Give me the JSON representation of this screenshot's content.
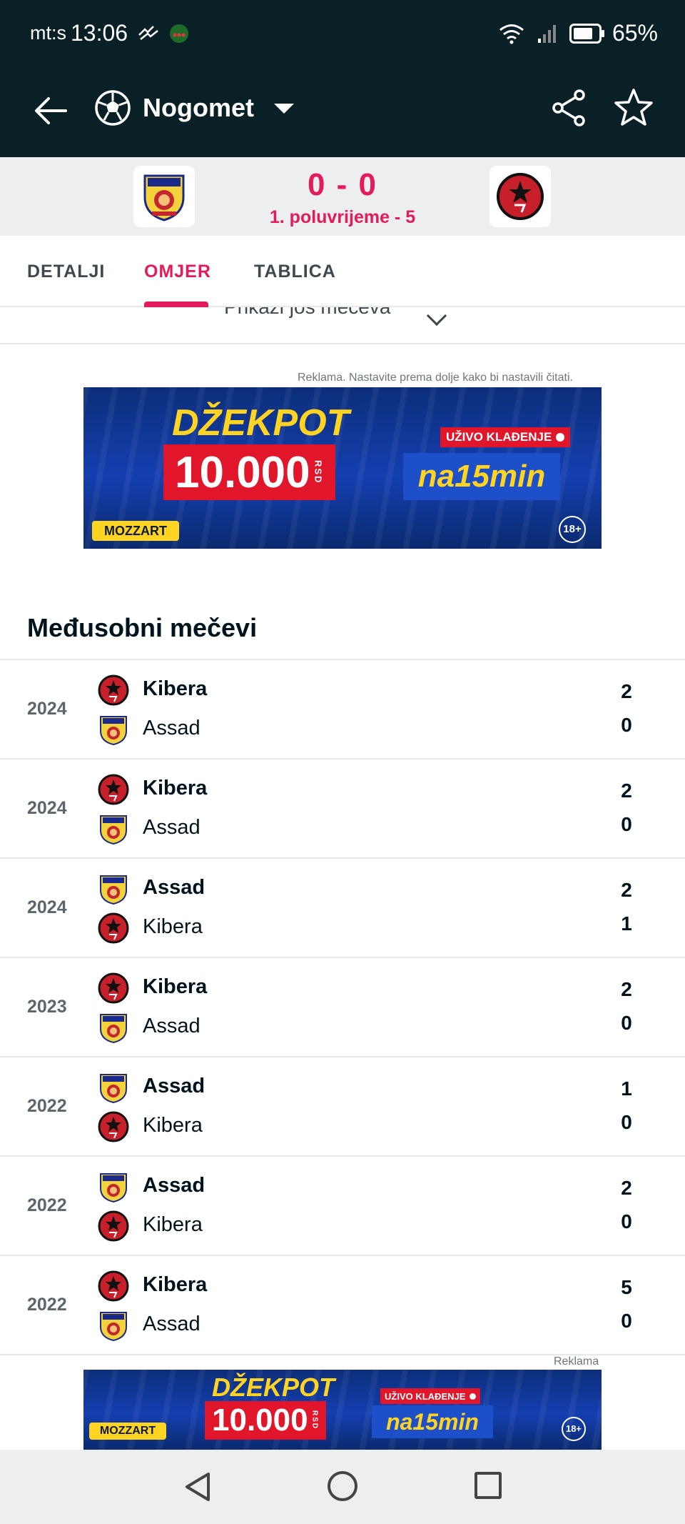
{
  "status_bar": {
    "carrier": "mt:s",
    "time": "13:06",
    "battery": "65%"
  },
  "header": {
    "sport": "Nogomet",
    "icons": [
      "back-arrow-icon",
      "soccer-ball-icon",
      "caret-down-icon",
      "share-icon",
      "star-icon"
    ]
  },
  "match": {
    "score": "0 - 0",
    "status": "1. poluvrijeme - 5",
    "home_team": "Assad",
    "away_team": "Kibera"
  },
  "tabs": [
    {
      "label": "DETALJI",
      "active": false
    },
    {
      "label": "OMJER",
      "active": true
    },
    {
      "label": "TABLICA",
      "active": false
    }
  ],
  "show_more": {
    "label": "Prikaži još mečeva"
  },
  "ad_top": {
    "note": "Reklama. Nastavite prema dolje kako bi nastavili čitati.",
    "jackpot": "DŽEKPOT",
    "amount": "10.000",
    "currency": "RSD",
    "live": "UŽIVO KLAĐENJE",
    "slogan": "na15min",
    "brand": "MOZZART",
    "age": "18+"
  },
  "h2h": {
    "title": "Međusobni mečevi",
    "rows": [
      {
        "year": "2024",
        "team1": "Kibera",
        "team2": "Assad",
        "score1": "2",
        "score2": "0"
      },
      {
        "year": "2024",
        "team1": "Kibera",
        "team2": "Assad",
        "score1": "2",
        "score2": "0"
      },
      {
        "year": "2024",
        "team1": "Assad",
        "team2": "Kibera",
        "score1": "2",
        "score2": "1"
      },
      {
        "year": "2023",
        "team1": "Kibera",
        "team2": "Assad",
        "score1": "2",
        "score2": "0"
      },
      {
        "year": "2022",
        "team1": "Assad",
        "team2": "Kibera",
        "score1": "1",
        "score2": "0"
      },
      {
        "year": "2022",
        "team1": "Assad",
        "team2": "Kibera",
        "score1": "2",
        "score2": "0"
      },
      {
        "year": "2022",
        "team1": "Kibera",
        "team2": "Assad",
        "score1": "5",
        "score2": "0"
      }
    ]
  },
  "ad_bottom": {
    "note": "Reklama",
    "jackpot": "DŽEKPOT",
    "amount": "10.000",
    "currency": "RSD",
    "live": "UŽIVO KLAĐENJE",
    "slogan": "na15min",
    "brand": "MOZZART",
    "age": "18+"
  },
  "colors": {
    "header_bg": "#0a2027",
    "accent": "#e31b5b",
    "scoreboard_bg": "#eceeef",
    "kibera_red": "#c8202a",
    "ad_blue": "#143fb0",
    "ad_yellow": "#ffd321"
  }
}
